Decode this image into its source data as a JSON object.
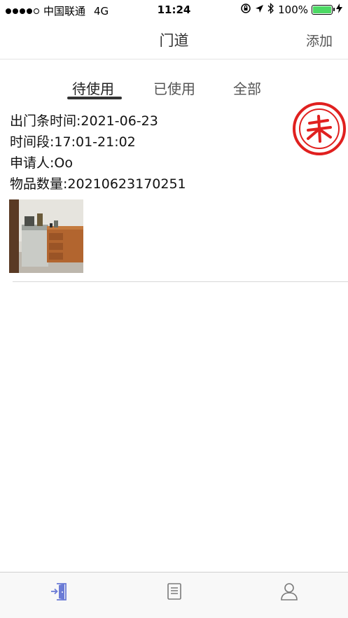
{
  "status_bar": {
    "carrier": "中国联通",
    "network": "4G",
    "time": "11:24",
    "battery": "100%",
    "battery_level": 1.0,
    "signal_bars": 4
  },
  "nav": {
    "title": "门道",
    "action_label": "添加"
  },
  "tabs": [
    {
      "label": "待使用",
      "active": true
    },
    {
      "label": "已使用",
      "active": false
    },
    {
      "label": "全部",
      "active": false
    }
  ],
  "record": {
    "exit_time_label": "出门条时间:",
    "exit_time": "2021-06-23",
    "period_label": "时间段:",
    "period": "17:01-21:02",
    "applicant_label": "申请人:",
    "applicant": "Oo",
    "quantity_label": "物品数量:",
    "quantity": "20210623170251",
    "stamp_text": "未",
    "stamp_color": "#e0201f"
  },
  "tab_bar": {
    "items": [
      {
        "icon": "door-exit-icon",
        "active": true
      },
      {
        "icon": "document-icon",
        "active": false
      },
      {
        "icon": "person-icon",
        "active": false
      }
    ],
    "active_color": "#6b7bd6",
    "inactive_color": "#7a7a7a"
  }
}
